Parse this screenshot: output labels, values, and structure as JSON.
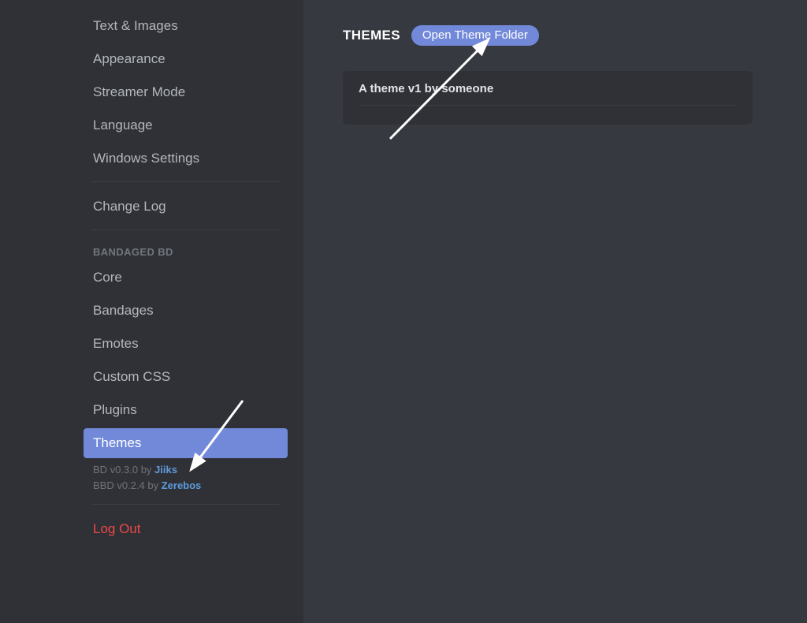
{
  "sidebar": {
    "app_settings": [
      {
        "label": "Text & Images"
      },
      {
        "label": "Appearance"
      },
      {
        "label": "Streamer Mode"
      },
      {
        "label": "Language"
      },
      {
        "label": "Windows Settings"
      }
    ],
    "change_log_label": "Change Log",
    "bbd_header": "BANDAGED BD",
    "bbd_items": [
      {
        "label": "Core",
        "selected": false
      },
      {
        "label": "Bandages",
        "selected": false
      },
      {
        "label": "Emotes",
        "selected": false
      },
      {
        "label": "Custom CSS",
        "selected": false
      },
      {
        "label": "Plugins",
        "selected": false
      },
      {
        "label": "Themes",
        "selected": true
      }
    ],
    "version_lines": {
      "bd_prefix": "BD v0.3.0 by ",
      "bd_author": "Jiiks",
      "bbd_prefix": "BBD v0.2.4 by ",
      "bbd_author": "Zerebos"
    },
    "logout_label": "Log Out"
  },
  "main": {
    "title": "THEMES",
    "open_folder_label": "Open Theme Folder",
    "theme_card_title": "A theme v1 by someone"
  },
  "colors": {
    "sidebar_bg": "#2f3136",
    "main_bg": "#36393f",
    "accent": "#7289da",
    "link": "#5f9bdc",
    "danger": "#f04747",
    "text_muted": "#72767d"
  }
}
